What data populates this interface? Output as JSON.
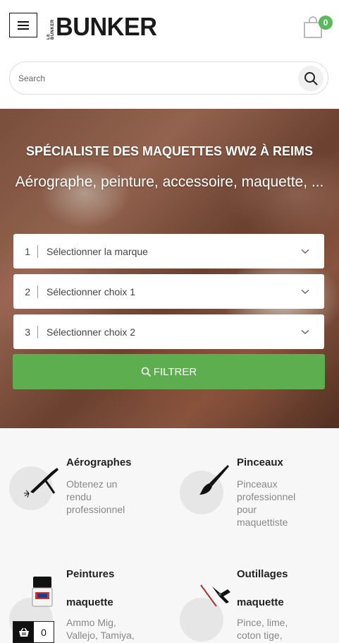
{
  "header": {
    "logo_text": "BUNKER",
    "logo_small_text": "LE BUNKER",
    "cart_count": "0"
  },
  "search": {
    "placeholder": "Search"
  },
  "hero": {
    "title": "SPÉCIALISTE DES MAQUETTES WW2 À REIMS",
    "subtitle": "Aérographe, peinture, accessoire, maquette, ...",
    "selects": [
      {
        "num": "1",
        "label": "Sélectionner la marque"
      },
      {
        "num": "2",
        "label": "Sélectionner choix 1"
      },
      {
        "num": "3",
        "label": "Sélectionner choix 2"
      }
    ],
    "filter_label": "FILTRER"
  },
  "categories": [
    {
      "title": "Aérographes",
      "desc": "Obtenez un rendu professionnel",
      "icon": "airbrush-icon"
    },
    {
      "title": "Pinceaux",
      "desc": "Pinceaux professionnel pour maquettiste",
      "icon": "paintbrush-icon"
    },
    {
      "title": "Peintures",
      "title2": "maquette",
      "desc": "Ammo Mig, Vallejo, Tamiya,",
      "icon": "paint-jar-icon"
    },
    {
      "title": "Outillages",
      "title2": "maquette",
      "desc": "Pince, lime, coton tige,",
      "icon": "pliers-icon"
    }
  ],
  "floating_basket": {
    "count": "0"
  },
  "colors": {
    "accent_green": "#5cae4f",
    "badge_green": "#5cb85c"
  }
}
